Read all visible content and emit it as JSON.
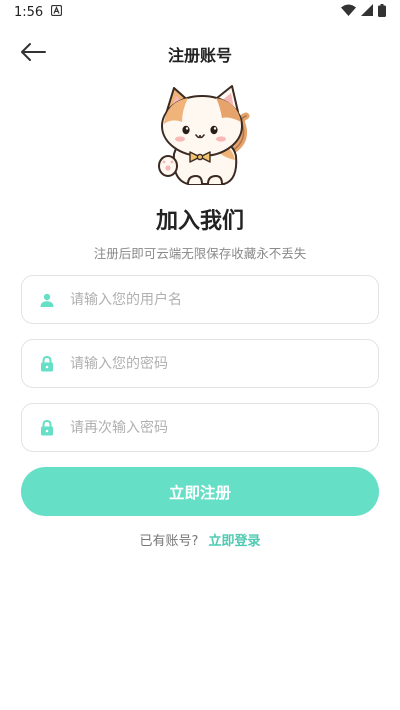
{
  "status_bar": {
    "time": "1:56",
    "icons": [
      "a-notification-icon",
      "wifi-icon",
      "signal-icon",
      "battery-icon"
    ]
  },
  "toolbar": {
    "back_icon": "arrow-left-icon",
    "title": "注册账号"
  },
  "hero": {
    "image": "cat-mascot",
    "heading": "加入我们",
    "subheading": "注册后即可云端无限保存收藏永不丢失"
  },
  "form": {
    "username": {
      "placeholder": "请输入您的用户名",
      "value": "",
      "icon": "user-icon"
    },
    "password": {
      "placeholder": "请输入您的密码",
      "value": "",
      "icon": "lock-icon"
    },
    "confirm_password": {
      "placeholder": "请再次输入密码",
      "value": "",
      "icon": "lock-icon"
    },
    "submit_label": "立即注册"
  },
  "footer": {
    "prompt": "已有账号?",
    "login_link": "立即登录"
  },
  "colors": {
    "accent": "#66dfc7",
    "link": "#4fc9b2",
    "icon": "#66dfc7"
  }
}
